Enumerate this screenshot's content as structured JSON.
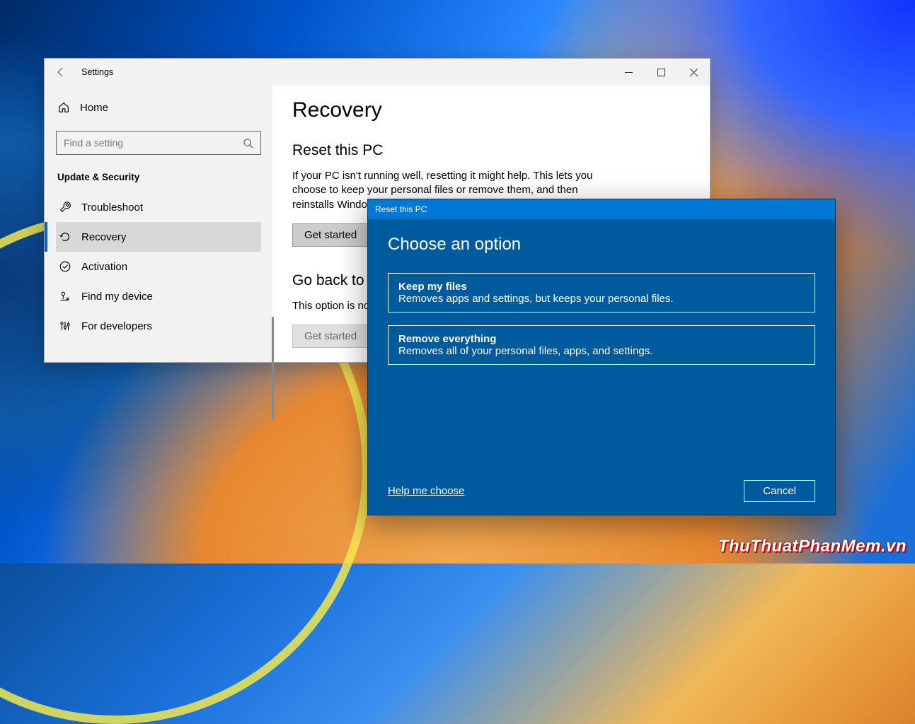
{
  "window": {
    "title": "Settings",
    "buttons": {
      "minimize": "minimize",
      "maximize": "maximize",
      "close": "close"
    }
  },
  "sidebar": {
    "home_label": "Home",
    "search_placeholder": "Find a setting",
    "group_label": "Update & Security",
    "items": [
      {
        "icon": "wrench-icon",
        "label": "Troubleshoot"
      },
      {
        "icon": "recovery-icon",
        "label": "Recovery"
      },
      {
        "icon": "check-circle-icon",
        "label": "Activation"
      },
      {
        "icon": "location-icon",
        "label": "Find my device"
      },
      {
        "icon": "sliders-icon",
        "label": "For developers"
      }
    ],
    "active_index": 1
  },
  "content": {
    "page_title": "Recovery",
    "sections": [
      {
        "title": "Reset this PC",
        "desc": "If your PC isn't running well, resetting it might help. This lets you choose to keep your personal files or remove them, and then reinstalls Windows.",
        "button_label": "Get started",
        "button_enabled": true
      },
      {
        "title": "Go back to t",
        "desc": "This option is no longer available because your PC was upgraded more than 10 days ago.",
        "button_label": "Get started",
        "button_enabled": false
      }
    ]
  },
  "dialog": {
    "titlebar": "Reset this PC",
    "title": "Choose an option",
    "options": [
      {
        "title": "Keep my files",
        "desc": "Removes apps and settings, but keeps your personal files."
      },
      {
        "title": "Remove everything",
        "desc": "Removes all of your personal files, apps, and settings."
      }
    ],
    "help_link": "Help me choose",
    "cancel_label": "Cancel"
  },
  "watermark": "ThuThuatPhanMem.vn"
}
